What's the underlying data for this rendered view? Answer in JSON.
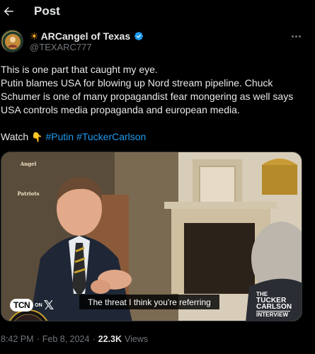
{
  "header": {
    "title": "Post"
  },
  "author": {
    "sun_emoji": "☀",
    "name": "ARCangel of Texas",
    "handle": "@TEXARC777"
  },
  "tweet": {
    "line1": "This is one part that caught my eye.",
    "line2": "Putin blames USA for blowing up Nord stream pipeline. Chuck Schumer is one of many propagandist fear mongering as well says USA controls media propaganda and european media.",
    "watch_label": "Watch",
    "hand_emoji": "👇",
    "hashtag1": "#Putin",
    "hashtag2": "#TuckerCarlson"
  },
  "media": {
    "badge_top": "Angel",
    "badge_bottom": "Patriots",
    "caption": "The threat I think you're referring",
    "tcn_label": "TCN",
    "tcn_on": "ON",
    "x_label": "𝕏",
    "interview_line1": "THE",
    "interview_line2": "TUCKER",
    "interview_line3": "CARLSON",
    "interview_line4": "INTERVIEW"
  },
  "meta": {
    "time": "8:42 PM",
    "sep1": "·",
    "date": "Feb 8, 2024",
    "sep2": "·",
    "views_count": "22.3K",
    "views_label": "Views"
  },
  "colors": {
    "accent": "#1d9bf0",
    "muted": "#71767b",
    "text": "#e7e9ea",
    "background": "#000000"
  }
}
